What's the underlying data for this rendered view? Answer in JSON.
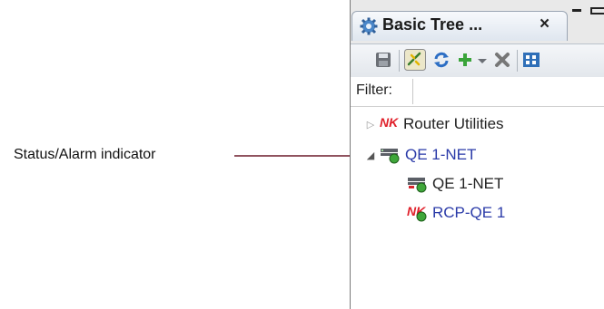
{
  "annotation": {
    "label": "Status/Alarm indicator"
  },
  "view": {
    "tab_title": "Basic Tree ...",
    "tab_close": "×",
    "tab_icon": "gear-icon"
  },
  "toolbar": {
    "items": [
      "save-icon",
      "link-icon",
      "refresh-icon",
      "add-icon",
      "dropdown-icon",
      "delete-icon",
      "grid-icon"
    ]
  },
  "filter": {
    "label": "Filter:",
    "value": ""
  },
  "tree": {
    "items": [
      {
        "label": "Router Utilities",
        "badge": "NK",
        "expanded": false,
        "level": 0,
        "color": "#222222"
      },
      {
        "label": "QE 1-NET",
        "icon": "device-status-icon",
        "expanded": true,
        "level": 0,
        "color": "#2a3aa8"
      },
      {
        "label": "QE 1-NET",
        "icon": "device-status-icon",
        "level": 1,
        "color": "#222222"
      },
      {
        "label": "RCP-QE 1",
        "badge": "NK",
        "icon": "status-dot",
        "level": 1,
        "color": "#2a3aa8"
      }
    ]
  },
  "colors": {
    "status_green": "#3fa63a",
    "nk_red": "#e0202a",
    "callout_line": "#6b1a2a"
  }
}
